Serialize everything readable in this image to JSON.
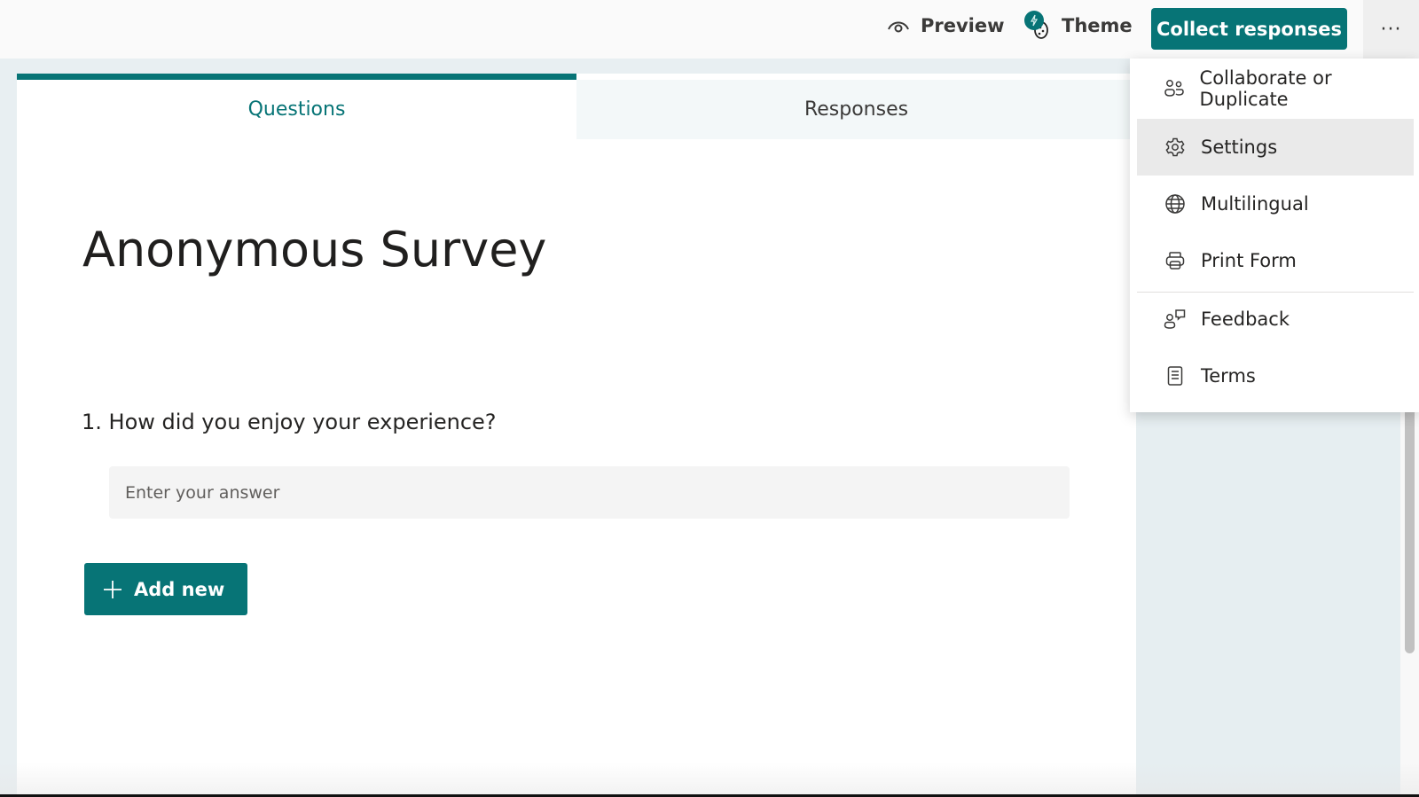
{
  "toolbar": {
    "preview_label": "Preview",
    "theme_label": "Theme",
    "collect_label": "Collect responses",
    "more_label": "···"
  },
  "tabs": [
    {
      "label": "Questions",
      "active": true
    },
    {
      "label": "Responses",
      "active": false
    }
  ],
  "form": {
    "title": "Anonymous Survey",
    "questions": [
      {
        "number": "1.",
        "text": "How did you enjoy your experience?",
        "placeholder": "Enter your answer",
        "value": ""
      }
    ],
    "add_new_label": "Add new"
  },
  "menu": {
    "items": [
      {
        "label": "Collaborate or Duplicate",
        "icon": "people-icon"
      },
      {
        "label": "Settings",
        "icon": "gear-icon",
        "hovered": true
      },
      {
        "label": "Multilingual",
        "icon": "globe-icon"
      },
      {
        "label": "Print Form",
        "icon": "printer-icon"
      },
      {
        "label": "Feedback",
        "icon": "feedback-icon"
      },
      {
        "label": "Terms",
        "icon": "document-icon"
      }
    ]
  },
  "colors": {
    "accent": "#077476",
    "menu_hover": "#eaeaea",
    "side_panel": "#e6eef1"
  }
}
